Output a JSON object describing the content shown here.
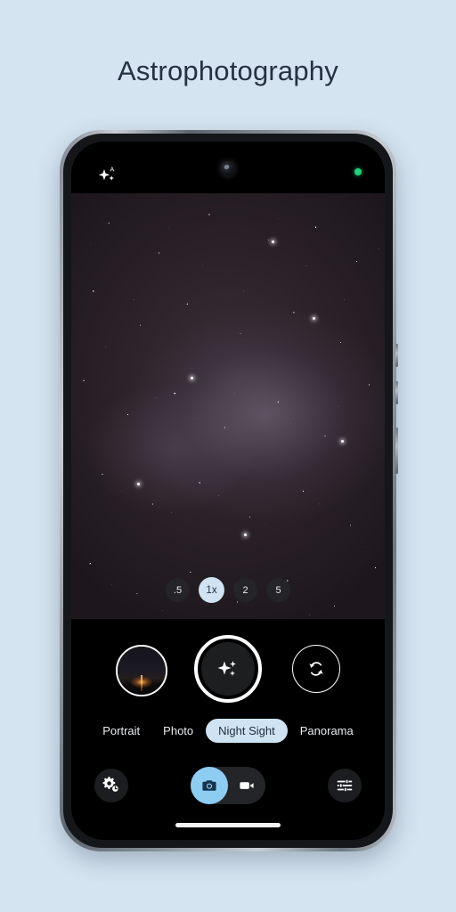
{
  "page": {
    "title": "Astrophotography",
    "background_color": "#d5e4f1",
    "title_color": "#263243"
  },
  "status_bar": {
    "left_icon": "sparkle-auto-icon",
    "left_icon_badge": "A",
    "center_icon": "front-camera-punch-hole",
    "right_indicator": "privacy-green-dot",
    "right_indicator_color": "#1fd17a"
  },
  "viewfinder": {
    "scene": "milky-way-night-sky",
    "zoom_levels": [
      {
        "label": ".5",
        "active": false
      },
      {
        "label": "1x",
        "active": true
      },
      {
        "label": "2",
        "active": false
      },
      {
        "label": "5",
        "active": false
      }
    ],
    "active_zoom": "1x",
    "active_zoom_bg": "#cfe3f2"
  },
  "shutter_row": {
    "thumbnail_label": "gallery-thumbnail",
    "shutter_label": "astro-shutter-button",
    "shutter_icon": "sparkle-icon",
    "flip_label": "switch-camera-button",
    "flip_icon": "camera-flip-icon"
  },
  "modes": {
    "items": [
      {
        "label": "Portrait",
        "active": false
      },
      {
        "label": "Photo",
        "active": false
      },
      {
        "label": "Night Sight",
        "active": true
      },
      {
        "label": "Panorama",
        "active": false
      }
    ],
    "active_mode": "Night Sight",
    "active_bg": "#cfe3f2",
    "active_fg": "#20303f"
  },
  "bottom_bar": {
    "settings_icon": "settings-gear-timer-icon",
    "tune_icon": "tune-sliders-icon",
    "capture_toggle": {
      "photo_icon": "camera-icon",
      "video_icon": "video-camera-icon",
      "active": "photo",
      "active_color": "#8ecdf2"
    },
    "home_indicator": "home-indicator-bar"
  }
}
